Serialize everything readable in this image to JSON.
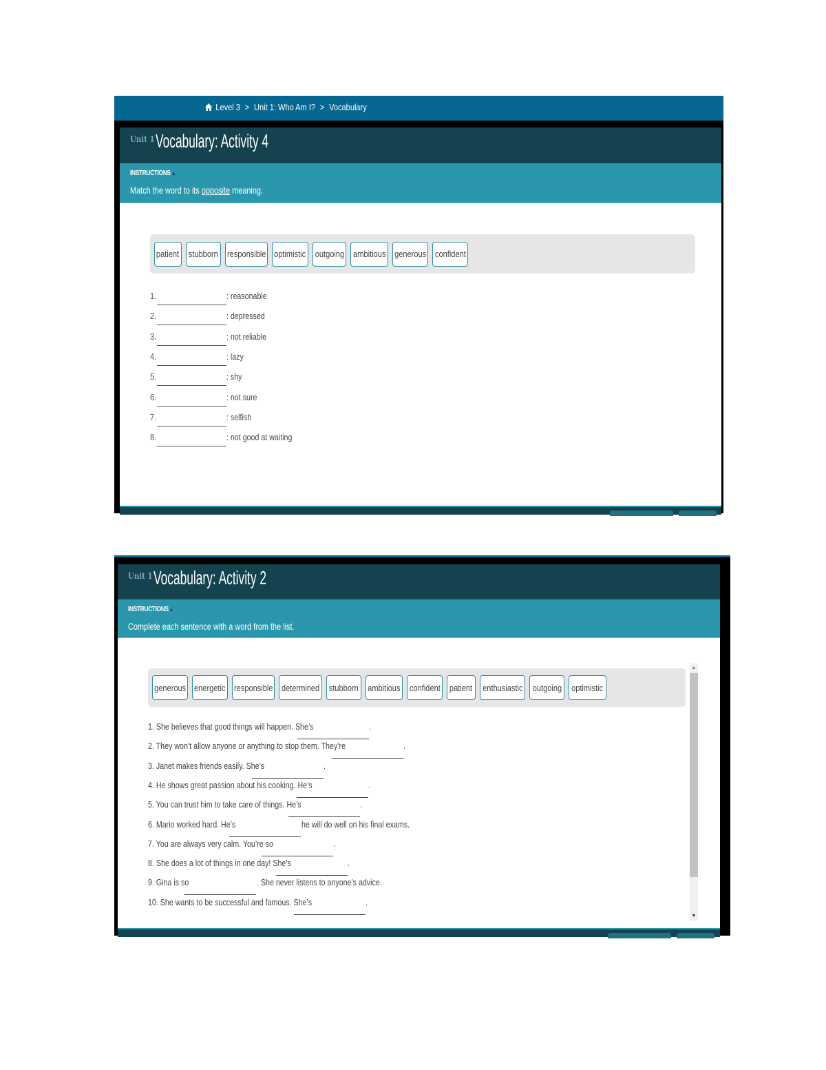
{
  "activity4": {
    "breadcrumb": {
      "home_icon": "home-icon",
      "items": [
        "Level 3",
        "Unit 1: Who Am I?",
        "Vocabulary"
      ],
      "separator": ">"
    },
    "unit_label": "Unit 1",
    "title": "Vocabulary: Activity 4",
    "instructions": {
      "heading": "INSTRUCTIONS",
      "toggle_icon": "▲",
      "text_before": "Match the word to its ",
      "text_link": "opposite",
      "text_after": " meaning."
    },
    "word_bank": [
      "patient",
      "stubborn",
      "responsible",
      "optimistic",
      "outgoing",
      "ambitious",
      "generous",
      "confident"
    ],
    "items": [
      {
        "num": "1.",
        "definition": ": reasonable",
        "answer": ""
      },
      {
        "num": "2.",
        "definition": ": depressed",
        "answer": ""
      },
      {
        "num": "3.",
        "definition": ": not reliable",
        "answer": ""
      },
      {
        "num": "4.",
        "definition": ": lazy",
        "answer": ""
      },
      {
        "num": "5.",
        "definition": ": shy",
        "answer": ""
      },
      {
        "num": "6.",
        "definition": ": not sure",
        "answer": ""
      },
      {
        "num": "7.",
        "definition": ": selfish",
        "answer": ""
      },
      {
        "num": "8.",
        "definition": ": not good at waiting",
        "answer": ""
      }
    ]
  },
  "activity2": {
    "unit_label": "Unit 1",
    "title": "Vocabulary: Activity 2",
    "instructions": {
      "heading": "INSTRUCTIONS",
      "toggle_icon": "▲",
      "text": "Complete each sentence with a word from the list."
    },
    "word_bank": [
      "generous",
      "energetic",
      "responsible",
      "determined",
      "stubborn",
      "ambitious",
      "confident",
      "patient",
      "enthusiastic",
      "outgoing",
      "optimistic"
    ],
    "sentences": [
      {
        "before": "1. She believes that good things will happen. She’s",
        "after": "."
      },
      {
        "before": "2. They won’t allow anyone or anything to stop them. They’re",
        "after": "."
      },
      {
        "before": "3. Janet makes friends easily. She’s",
        "after": "."
      },
      {
        "before": "4. He shows great passion about his cooking. He’s",
        "after": "."
      },
      {
        "before": "5. You can trust him to take care of things. He’s",
        "after": "."
      },
      {
        "before": "6. Mario worked hard. He’s",
        "after": "he will do well on his final exams."
      },
      {
        "before": "7. You are always very calm. You’re so",
        "after": "."
      },
      {
        "before": "8. She does a lot of things in one day! She’s",
        "after": "."
      },
      {
        "before": "9. Gina is so",
        "after": ". She never listens to anyone’s advice."
      },
      {
        "before": "10. She wants to be successful and famous. She’s",
        "after": "."
      }
    ],
    "scrollbar": {
      "up_icon": "▲",
      "down_icon": "▼"
    }
  }
}
